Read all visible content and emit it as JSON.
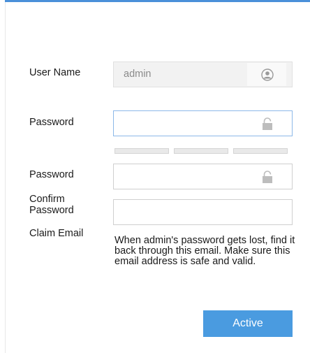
{
  "form": {
    "username_label": "User Name",
    "username_value": "admin",
    "password_label": "Password",
    "password_value": "",
    "confirm_label_line1": "Password",
    "confirm_label_line2": "Confirm",
    "confirm_label_line3": "Password",
    "confirm_value": "",
    "claim_email_label": "Claim Email",
    "claim_email_value": "",
    "claim_email_help": "When admin's password gets lost, find it back through this email. Make sure this email address is safe and valid.",
    "active_button": "Active"
  },
  "icons": {
    "username": "user-icon",
    "password": "lock-icon",
    "confirm_password": "lock-icon"
  },
  "password_strength": {
    "segments": 3,
    "filled": 0
  },
  "colors": {
    "accent": "#4a90d9",
    "button": "#4a9be0",
    "focus_border": "#8cb8e8"
  }
}
